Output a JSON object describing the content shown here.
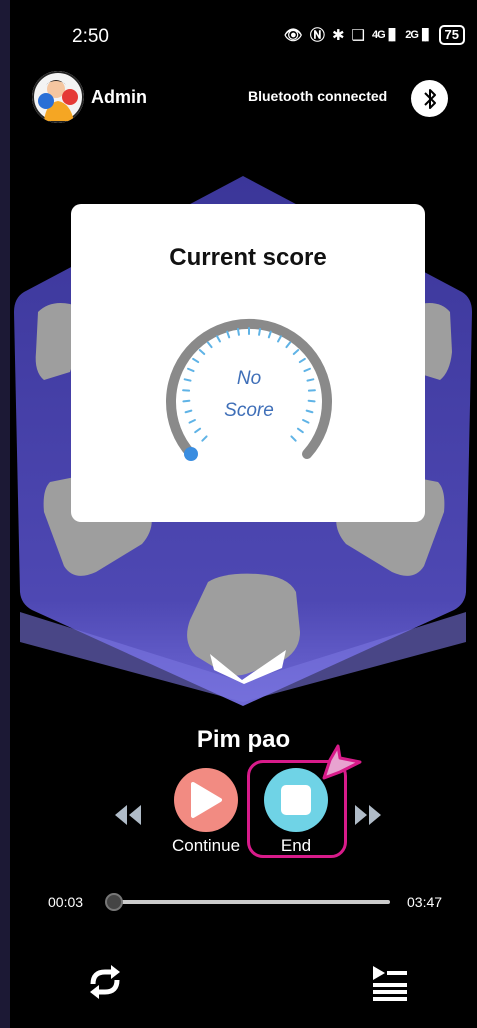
{
  "status_bar": {
    "time": "2:50",
    "network_1": "4G",
    "network_2": "2G",
    "battery": "75"
  },
  "header": {
    "username": "Admin",
    "bluetooth_status": "Bluetooth connected"
  },
  "score_card": {
    "title": "Current score",
    "score_line_1": "No",
    "score_line_2": "Score"
  },
  "player": {
    "track_name": "Pim pao",
    "continue_label": "Continue",
    "end_label": "End",
    "current_time": "00:03",
    "total_time": "03:47",
    "progress": 0.01
  },
  "colors": {
    "pad_purple": "#4b44a8",
    "pad_button_gray": "#9e9e9e",
    "continue_color": "#f28b82",
    "end_color": "#6fd3e6",
    "highlight": "#d81b8a",
    "gauge_dot": "#3a8de0"
  },
  "icons": {
    "bluetooth": "bluetooth-icon",
    "previous": "rewind-icon",
    "next": "fast-forward-icon",
    "repeat": "repeat-icon",
    "playlist": "playlist-icon"
  }
}
